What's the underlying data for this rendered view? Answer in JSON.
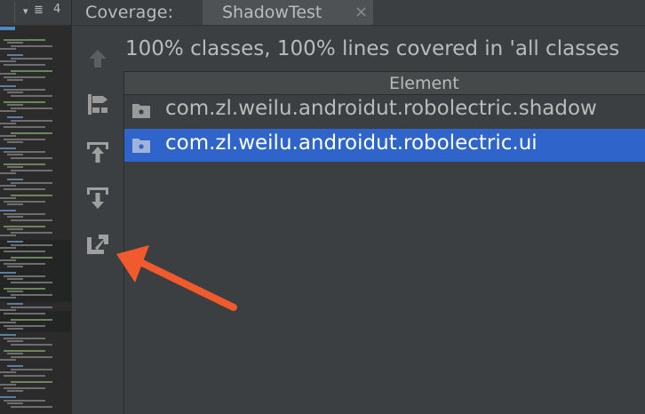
{
  "header": {
    "left_panel_count": "4",
    "coverage_label": "Coverage:",
    "tabs": [
      {
        "label": "ShadowTest",
        "close": "×"
      }
    ]
  },
  "summary_text": "100% classes, 100% lines covered in 'all classes",
  "table": {
    "column_header": "Element",
    "rows": [
      {
        "label": "com.zl.weilu.androidut.robolectric.shadow",
        "icon": "package-folder-icon",
        "selected": false
      },
      {
        "label": "com.zl.weilu.androidut.robolectric.ui",
        "icon": "package-folder-icon",
        "selected": true
      }
    ]
  },
  "toolbar": {
    "icons": [
      "up-arrow-icon",
      "flatten-packages-icon",
      "import-icon",
      "export-icon",
      "generate-report-icon"
    ]
  },
  "colors": {
    "selection": "#2f65ca",
    "annotation_arrow": "#f05a2d",
    "background": "#3c3f41"
  }
}
